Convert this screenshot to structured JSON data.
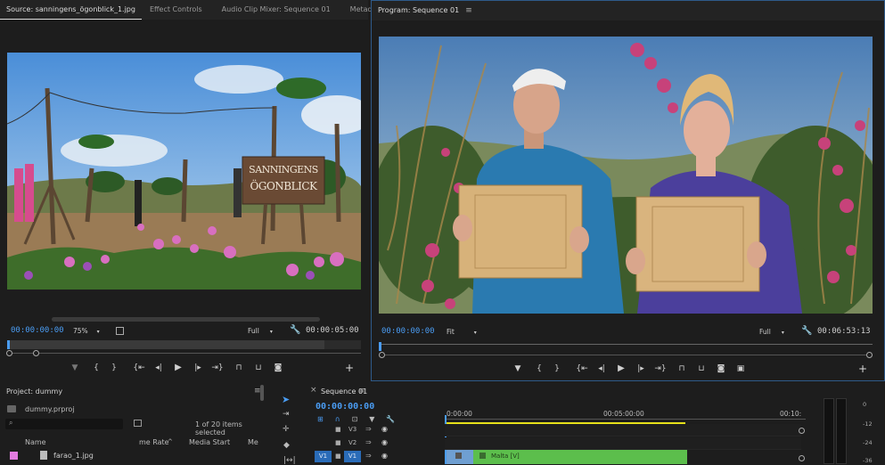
{
  "source": {
    "tabs": [
      {
        "label": "Source: sanningens_ögonblick_1.jpg",
        "active": true
      },
      {
        "label": "Effect Controls",
        "active": false
      },
      {
        "label": "Audio Clip Mixer: Sequence 01",
        "active": false
      },
      {
        "label": "Metadata",
        "active": false
      }
    ],
    "overflow": "»",
    "sign_line1": "SANNINGENS",
    "sign_line2": "ÖGONBLICK",
    "timecode": "00:00:00:00",
    "zoom": "75%",
    "resolution": "Full",
    "duration": "00:00:05:00"
  },
  "program": {
    "title": "Program: Sequence 01",
    "timecode": "00:00:00:00",
    "zoom": "Fit",
    "resolution": "Full",
    "duration": "00:06:53:13"
  },
  "project": {
    "title": "Project: dummy",
    "file": "dummy.prproj",
    "search_placeholder": "",
    "items_count": "1 of 20 items selected",
    "columns": [
      "Name",
      "me Rate",
      "Media Start",
      "Me"
    ],
    "rows": [
      {
        "name": "farao_1.jpg",
        "color": "#e37ce0"
      }
    ]
  },
  "timeline": {
    "title": "Sequence 01",
    "timecode": "00:00:00:00",
    "ruler": [
      "0:00:00",
      "00:05:00:00",
      "00:10:"
    ],
    "tracks": [
      "V3",
      "V2",
      "V1"
    ],
    "source_patch": "V1",
    "clip_label": "Malta [V]"
  },
  "meter": {
    "labels": [
      "0",
      "-12",
      "-24",
      "-36"
    ]
  },
  "colors": {
    "accent": "#4a9cf2",
    "clip": "#5cbe4c",
    "workarea": "#e6e01a",
    "track_active": "#2a6cb8"
  }
}
